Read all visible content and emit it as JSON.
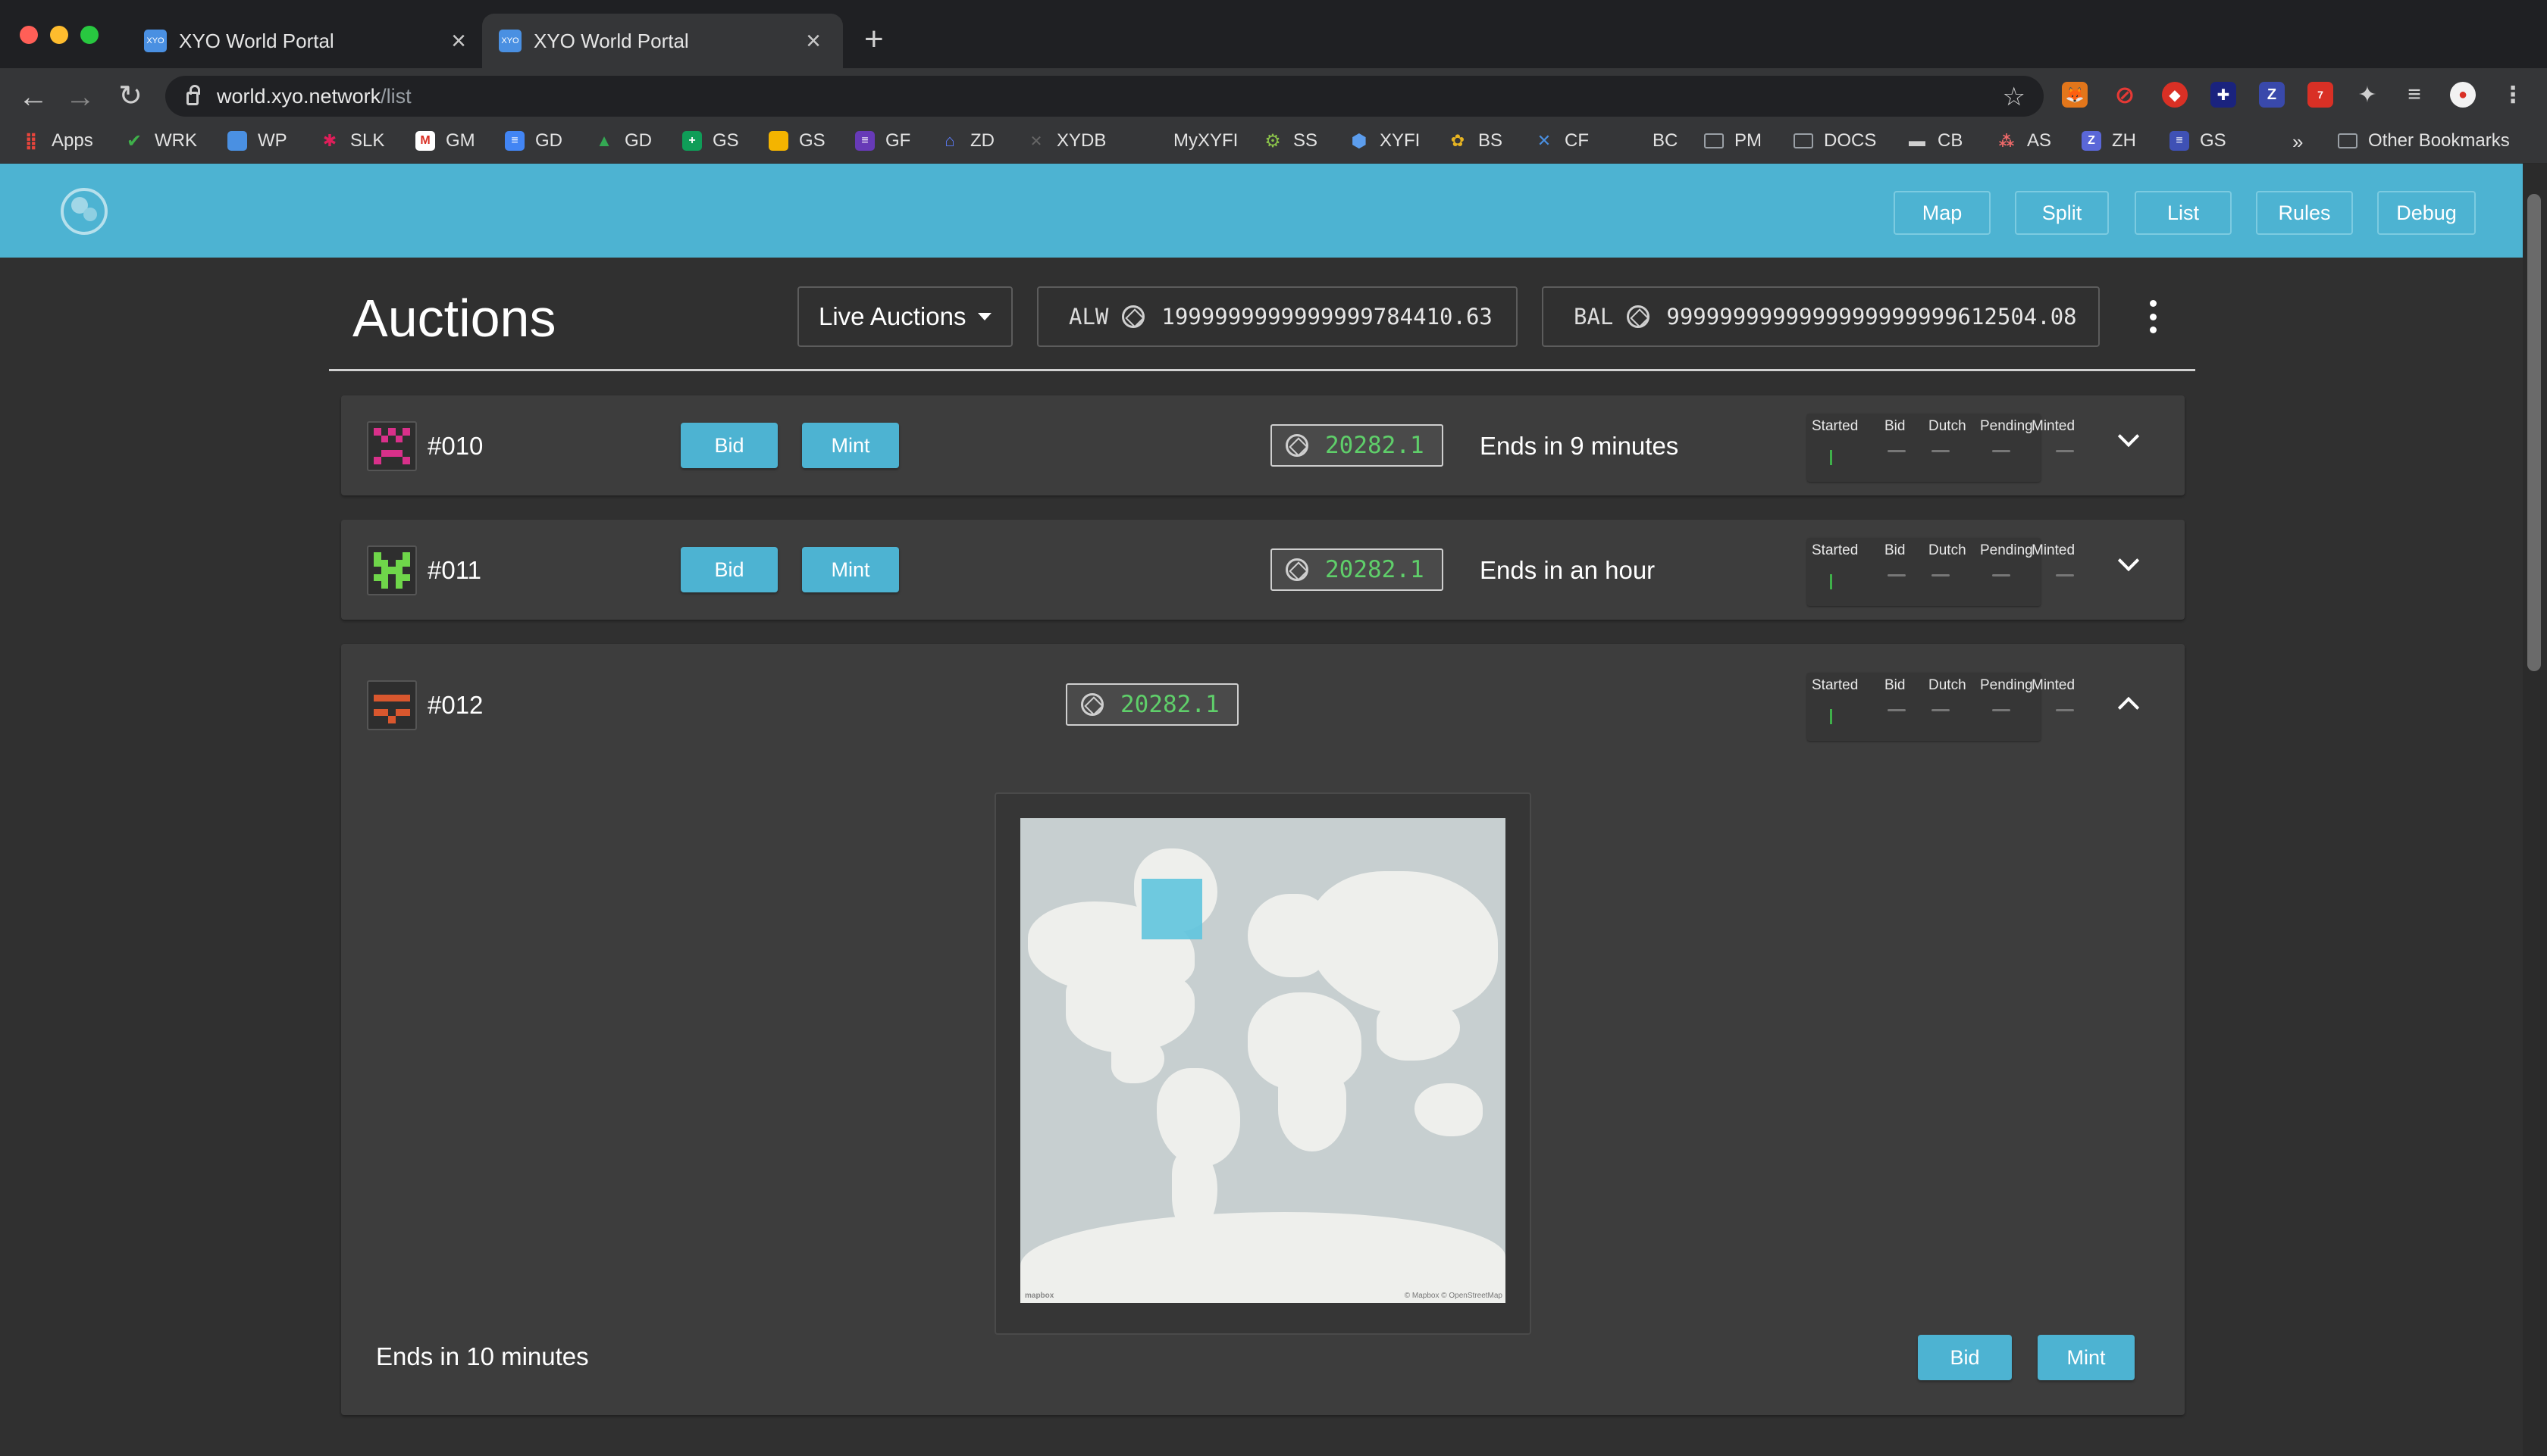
{
  "browser": {
    "tabs": [
      {
        "title": "XYO World Portal",
        "favicon": "XYO",
        "active": false
      },
      {
        "title": "XYO World Portal",
        "favicon": "XYO",
        "active": true
      }
    ],
    "url": {
      "host": "world.xyo.network",
      "path": "/list"
    },
    "bookmarks": [
      {
        "label": "Apps",
        "icon": "apps-grid-icon",
        "color": "#e8453c"
      },
      {
        "label": "WRK",
        "icon": "check-icon",
        "color": "#3fb04a"
      },
      {
        "label": "WP",
        "icon": "wp-icon",
        "color": "#4a90e2"
      },
      {
        "label": "SLK",
        "icon": "slack-icon",
        "color": "#e01e5a"
      },
      {
        "label": "GM",
        "icon": "gmail-icon",
        "color": "#d93025"
      },
      {
        "label": "GD",
        "icon": "docs-icon",
        "color": "#4285f4"
      },
      {
        "label": "GD",
        "icon": "drive-icon",
        "color": "#34a853"
      },
      {
        "label": "GS",
        "icon": "sheets-icon",
        "color": "#0f9d58"
      },
      {
        "label": "GS",
        "icon": "slides-icon",
        "color": "#f4b400"
      },
      {
        "label": "GF",
        "icon": "forms-icon",
        "color": "#673ab7"
      },
      {
        "label": "ZD",
        "icon": "zd-icon",
        "color": "#1f73b7"
      },
      {
        "label": "XYDB",
        "icon": "xy-icon",
        "color": "#555555"
      },
      {
        "label": "MyXYFI",
        "icon": "blank-icon",
        "color": "#353638"
      },
      {
        "label": "SS",
        "icon": "gear-icon",
        "color": "#8bc34a"
      },
      {
        "label": "XYFI",
        "icon": "cube-icon",
        "color": "#5c9ded"
      },
      {
        "label": "BS",
        "icon": "bs-icon",
        "color": "#e6b422"
      },
      {
        "label": "CF",
        "icon": "cf-icon",
        "color": "#4a90e2"
      },
      {
        "label": "BC",
        "icon": "blank-icon",
        "color": "#353638"
      },
      {
        "label": "PM",
        "icon": "folder-icon",
        "color": "#9aa0a6"
      },
      {
        "label": "DOCS",
        "icon": "folder-icon",
        "color": "#9aa0a6"
      },
      {
        "label": "CB",
        "icon": "truck-icon",
        "color": "#cfcfcf"
      },
      {
        "label": "AS",
        "icon": "asana-icon",
        "color": "#f06a6a"
      },
      {
        "label": "ZH",
        "icon": "z-icon",
        "color": "#5a67d8"
      },
      {
        "label": "GS",
        "icon": "gs-icon",
        "color": "#3f51b5"
      }
    ],
    "overflow": "»",
    "other_bookmarks": "Other Bookmarks"
  },
  "app": {
    "nav": [
      {
        "label": "Map"
      },
      {
        "label": "Split"
      },
      {
        "label": "List"
      },
      {
        "label": "Rules"
      },
      {
        "label": "Debug"
      }
    ],
    "heading": "Auctions",
    "filter": {
      "value": "Live Auctions"
    },
    "alw": {
      "label": "ALW",
      "value": "1999999999999999784410.63"
    },
    "bal": {
      "label": "BAL",
      "value": "9999999999999999999999612504.08"
    },
    "status_columns": [
      "Started",
      "Bid",
      "Dutch",
      "Pending",
      "Minted"
    ],
    "auctions": [
      {
        "id": "#010",
        "price": "20282.1",
        "ends": "Ends in 9 minutes",
        "bid_label": "Bid",
        "mint_label": "Mint",
        "expanded": false,
        "avatar_color": "#d9308a",
        "status": [
          true,
          false,
          false,
          false,
          false
        ]
      },
      {
        "id": "#011",
        "price": "20282.1",
        "ends": "Ends in an hour",
        "bid_label": "Bid",
        "mint_label": "Mint",
        "expanded": false,
        "avatar_color": "#6fd64a",
        "status": [
          true,
          false,
          false,
          false,
          false
        ]
      },
      {
        "id": "#012",
        "price": "20282.1",
        "ends": "Ends in 10 minutes",
        "bid_label": "Bid",
        "mint_label": "Mint",
        "expanded": true,
        "avatar_color": "#d9572e",
        "status": [
          true,
          false,
          false,
          false,
          false
        ]
      }
    ],
    "map": {
      "logo": "mapbox",
      "attribution": "© Mapbox © OpenStreetMap",
      "highlight_color": "#5fc4de"
    }
  }
}
